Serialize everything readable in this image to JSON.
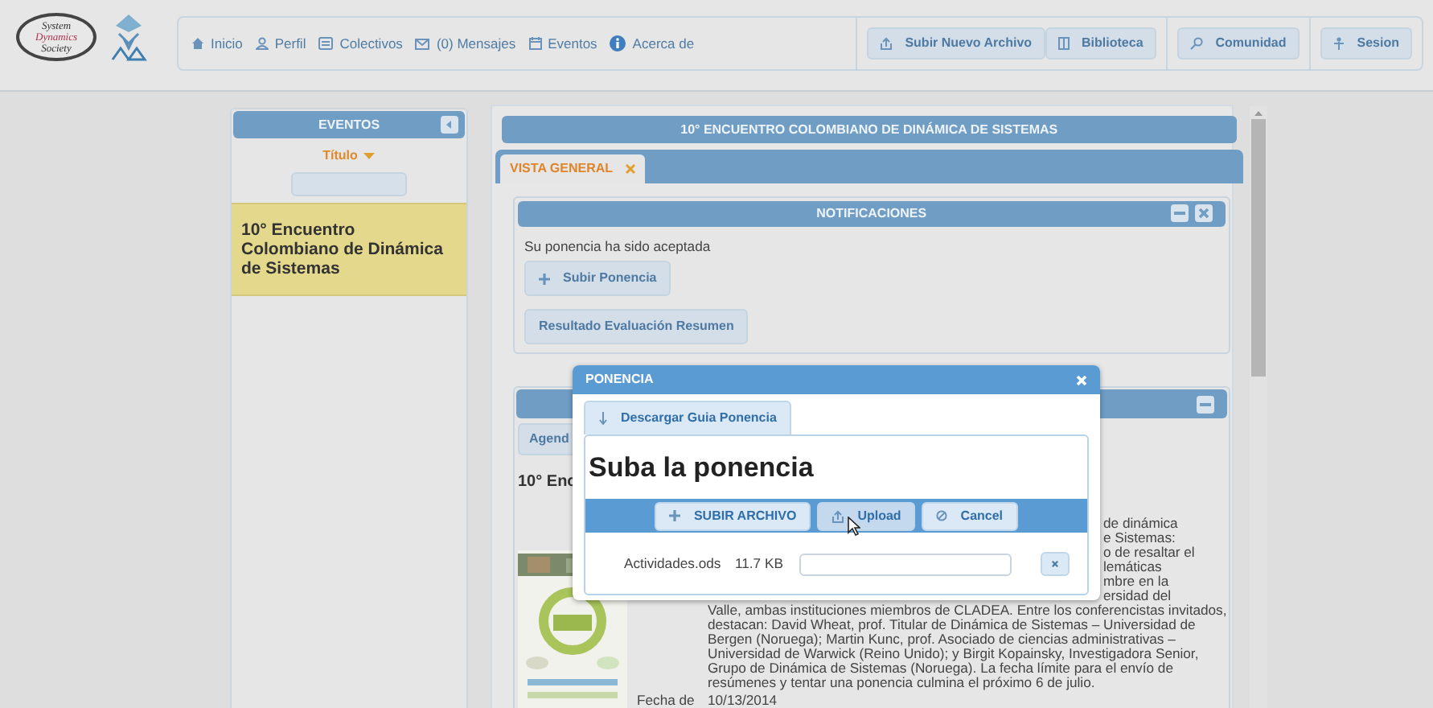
{
  "logo": {
    "lines": [
      "System",
      "Dynamics",
      "Society"
    ]
  },
  "nav_links": [
    {
      "label": "Inicio",
      "kind": "home"
    },
    {
      "label": "Perfil",
      "kind": "user"
    },
    {
      "label": "Colectivos",
      "kind": "list"
    },
    {
      "label": "(0) Mensajes",
      "kind": "mail"
    },
    {
      "label": "Eventos",
      "kind": "calendar"
    },
    {
      "label": "Acerca de",
      "kind": "info"
    }
  ],
  "toolbar_groups": [
    [
      {
        "label": "Subir Nuevo Archivo",
        "kind": "upload"
      },
      {
        "label": "Biblioteca",
        "kind": "book"
      }
    ],
    [
      {
        "label": "Comunidad",
        "kind": "search"
      }
    ],
    [
      {
        "label": "Sesion",
        "kind": "person"
      }
    ]
  ],
  "events_panel": {
    "title": "EVENTOS",
    "sort_label": "Título",
    "items": [
      {
        "title": "10° Encuentro Colombiano de Dinámica de Sistemas",
        "selected": true
      }
    ]
  },
  "event": {
    "title": "10° ENCUENTRO COLOMBIANO DE DINÁMICA DE SISTEMAS",
    "tabs": [
      {
        "label": "VISTA GENERAL",
        "selected": true
      }
    ],
    "notifications": {
      "title": "NOTIFICACIONES",
      "message": "Su ponencia ha sido aceptada",
      "buttons": [
        {
          "label": "Subir Ponencia",
          "kind": "add"
        },
        {
          "label": "Resultado Evaluación Resumen",
          "kind": "plain"
        }
      ]
    },
    "details": {
      "tab": "Agend",
      "heading": "10° Enc",
      "lines": [
        {
          "text": "de dinámica",
          "partly_hidden": true
        },
        {
          "text": "e Sistemas:",
          "partly_hidden": true
        },
        {
          "text": "o de resaltar el",
          "partly_hidden": true
        },
        {
          "text": "lemáticas",
          "partly_hidden": true
        },
        {
          "text": "mbre en la",
          "partly_hidden": true
        },
        {
          "text": "ersidad del",
          "partly_hidden": true
        },
        {
          "text": "Valle, ambas instituciones miembros de CLADEA. Entre los conferencistas invitados,",
          "partly_hidden": false
        },
        {
          "text": "destacan: David Wheat, prof. Titular de Dinámica de Sistemas – Universidad de",
          "partly_hidden": false
        },
        {
          "text": "Bergen (Noruega); Martin Kunc, prof. Asociado de ciencias administrativas –",
          "partly_hidden": false
        },
        {
          "text": "Universidad de Warwick (Reino Unido); y Birgit Kopainsky, Investigadora Senior,",
          "partly_hidden": false
        },
        {
          "text": "Grupo de Dinámica de Sistemas (Noruega). La fecha límite para el envío de",
          "partly_hidden": false
        },
        {
          "text": "resúmenes y tentar una ponencia culmina el próximo 6 de julio.",
          "partly_hidden": false
        }
      ],
      "date_label": "Fecha de",
      "date": "10/13/2014"
    }
  },
  "dialog": {
    "title": "PONENCIA",
    "download_button": "Descargar Guia Ponencia",
    "heading": "Suba la ponencia",
    "actions": [
      {
        "label": "SUBIR ARCHIVO",
        "kind": "add",
        "hovered": false
      },
      {
        "label": "Upload",
        "kind": "upload",
        "hovered": true
      },
      {
        "label": "Cancel",
        "kind": "cancel",
        "hovered": false
      }
    ],
    "files": [
      {
        "name": "Actividades.ods",
        "size": "11.7 KB"
      }
    ]
  }
}
